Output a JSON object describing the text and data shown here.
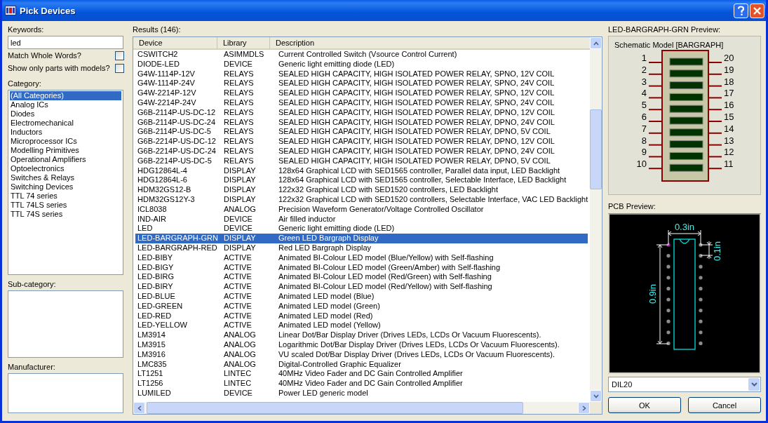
{
  "window": {
    "title": "Pick Devices"
  },
  "keywords": {
    "label": "Keywords:",
    "value": "led"
  },
  "options": [
    {
      "label": "Match Whole Words?",
      "checked": false
    },
    {
      "label": "Show only parts with models?",
      "checked": false
    }
  ],
  "category": {
    "label": "Category:",
    "items": [
      {
        "label": "(All Categories)",
        "selected": true
      },
      {
        "label": "Analog ICs",
        "selected": false
      },
      {
        "label": "Diodes",
        "selected": false
      },
      {
        "label": "Electromechanical",
        "selected": false
      },
      {
        "label": "Inductors",
        "selected": false
      },
      {
        "label": "Microprocessor ICs",
        "selected": false
      },
      {
        "label": "Modelling Primitives",
        "selected": false
      },
      {
        "label": "Operational Amplifiers",
        "selected": false
      },
      {
        "label": "Optoelectronics",
        "selected": false
      },
      {
        "label": "Switches & Relays",
        "selected": false
      },
      {
        "label": "Switching Devices",
        "selected": false
      },
      {
        "label": "TTL 74 series",
        "selected": false
      },
      {
        "label": "TTL 74LS series",
        "selected": false
      },
      {
        "label": "TTL 74S series",
        "selected": false
      }
    ]
  },
  "subcategory": {
    "label": "Sub-category:"
  },
  "manufacturer": {
    "label": "Manufacturer:"
  },
  "results": {
    "label": "Results (146):",
    "columns": [
      "Device",
      "Library",
      "Description"
    ],
    "rows": [
      {
        "device": "CSWITCH2",
        "library": "ASIMMDLS",
        "description": "Current Controlled Switch (Vsource Control Current)",
        "selected": false
      },
      {
        "device": "DIODE-LED",
        "library": "DEVICE",
        "description": "Generic light emitting diode (LED)",
        "selected": false
      },
      {
        "device": "G4W-1114P-12V",
        "library": "RELAYS",
        "description": "SEALED HIGH CAPACITY, HIGH ISOLATED POWER RELAY, SPNO, 12V COIL",
        "selected": false
      },
      {
        "device": "G4W-1114P-24V",
        "library": "RELAYS",
        "description": "SEALED HIGH CAPACITY, HIGH ISOLATED POWER RELAY, SPNO, 24V COIL",
        "selected": false
      },
      {
        "device": "G4W-2214P-12V",
        "library": "RELAYS",
        "description": "SEALED HIGH CAPACITY, HIGH ISOLATED POWER RELAY, SPNO, 12V COIL",
        "selected": false
      },
      {
        "device": "G4W-2214P-24V",
        "library": "RELAYS",
        "description": "SEALED HIGH CAPACITY, HIGH ISOLATED POWER RELAY, SPNO, 24V COIL",
        "selected": false
      },
      {
        "device": "G6B-2114P-US-DC-12",
        "library": "RELAYS",
        "description": "SEALED HIGH CAPACITY, HIGH ISOLATED POWER RELAY, DPNO, 12V COIL",
        "selected": false
      },
      {
        "device": "G6B-2114P-US-DC-24",
        "library": "RELAYS",
        "description": "SEALED HIGH CAPACITY, HIGH ISOLATED POWER RELAY, DPNO, 24V COIL",
        "selected": false
      },
      {
        "device": "G6B-2114P-US-DC-5",
        "library": "RELAYS",
        "description": "SEALED HIGH CAPACITY, HIGH ISOLATED POWER RELAY, DPNO, 5V COIL",
        "selected": false
      },
      {
        "device": "G6B-2214P-US-DC-12",
        "library": "RELAYS",
        "description": "SEALED HIGH CAPACITY, HIGH ISOLATED POWER RELAY, DPNO, 12V COIL",
        "selected": false
      },
      {
        "device": "G6B-2214P-US-DC-24",
        "library": "RELAYS",
        "description": "SEALED HIGH CAPACITY, HIGH ISOLATED POWER RELAY, DPNO, 24V COIL",
        "selected": false
      },
      {
        "device": "G6B-2214P-US-DC-5",
        "library": "RELAYS",
        "description": "SEALED HIGH CAPACITY, HIGH ISOLATED POWER RELAY, DPNO, 5V COIL",
        "selected": false
      },
      {
        "device": "HDG12864L-4",
        "library": "DISPLAY",
        "description": "128x64 Graphical LCD with SED1565 controller, Parallel data input, LED Backlight",
        "selected": false
      },
      {
        "device": "HDG12864L-6",
        "library": "DISPLAY",
        "description": "128x64 Graphical LCD with SED1565 controller, Selectable Interface, LED Backlight",
        "selected": false
      },
      {
        "device": "HDM32GS12-B",
        "library": "DISPLAY",
        "description": "122x32 Graphical LCD with SED1520 controllers, LED Backlight",
        "selected": false
      },
      {
        "device": "HDM32GS12Y-3",
        "library": "DISPLAY",
        "description": "122x32 Graphical LCD with SED1520 controllers, Selectable Interface, VAC LED Backlight",
        "selected": false
      },
      {
        "device": "ICL8038",
        "library": "ANALOG",
        "description": "Precision Waveform Generator/Voltage Controlled Oscillator",
        "selected": false
      },
      {
        "device": "IND-AIR",
        "library": "DEVICE",
        "description": "Air filled inductor",
        "selected": false
      },
      {
        "device": "LED",
        "library": "DEVICE",
        "description": "Generic light emitting diode (LED)",
        "selected": false
      },
      {
        "device": "LED-BARGRAPH-GRN",
        "library": "DISPLAY",
        "description": "Green LED Bargraph Display",
        "selected": true
      },
      {
        "device": "LED-BARGRAPH-RED",
        "library": "DISPLAY",
        "description": "Red LED Bargraph Display",
        "selected": false
      },
      {
        "device": "LED-BIBY",
        "library": "ACTIVE",
        "description": "Animated BI-Colour LED model (Blue/Yellow) with Self-flashing",
        "selected": false
      },
      {
        "device": "LED-BIGY",
        "library": "ACTIVE",
        "description": "Animated BI-Colour LED model (Green/Amber) with Self-flashing",
        "selected": false
      },
      {
        "device": "LED-BIRG",
        "library": "ACTIVE",
        "description": "Animated BI-Colour LED model (Red/Green) with Self-flashing",
        "selected": false
      },
      {
        "device": "LED-BIRY",
        "library": "ACTIVE",
        "description": "Animated BI-Colour LED model (Red/Yellow) with Self-flashing",
        "selected": false
      },
      {
        "device": "LED-BLUE",
        "library": "ACTIVE",
        "description": "Animated LED model (Blue)",
        "selected": false
      },
      {
        "device": "LED-GREEN",
        "library": "ACTIVE",
        "description": "Animated LED model (Green)",
        "selected": false
      },
      {
        "device": "LED-RED",
        "library": "ACTIVE",
        "description": "Animated LED model (Red)",
        "selected": false
      },
      {
        "device": "LED-YELLOW",
        "library": "ACTIVE",
        "description": "Animated LED model (Yellow)",
        "selected": false
      },
      {
        "device": "LM3914",
        "library": "ANALOG",
        "description": "Linear Dot/Bar Display Driver (Drives LEDs, LCDs Or Vacuum Fluorescents).",
        "selected": false
      },
      {
        "device": "LM3915",
        "library": "ANALOG",
        "description": "Logarithmic Dot/Bar Display Driver (Drives LEDs, LCDs Or Vacuum Fluorescents).",
        "selected": false
      },
      {
        "device": "LM3916",
        "library": "ANALOG",
        "description": "VU scaled Dot/Bar Display Driver (Drives LEDs, LCDs Or Vacuum Fluorescents).",
        "selected": false
      },
      {
        "device": "LMC835",
        "library": "ANALOG",
        "description": "Digital-Controlled Graphic Equalizer",
        "selected": false
      },
      {
        "device": "LT1251",
        "library": "LINTEC",
        "description": "40MHz Video Fader and  DC Gain Controlled Amplifier",
        "selected": false
      },
      {
        "device": "LT1256",
        "library": "LINTEC",
        "description": "40MHz Video Fader and  DC Gain Controlled Amplifier",
        "selected": false
      },
      {
        "device": "LUMILED",
        "library": "DEVICE",
        "description": "Power LED generic model",
        "selected": false
      }
    ]
  },
  "preview": {
    "label": "LED-BARGRAPH-GRN Preview:",
    "schematic_title": "Schematic Model [BARGRAPH]",
    "left_pins": [
      "1",
      "2",
      "3",
      "4",
      "5",
      "6",
      "7",
      "8",
      "9",
      "10"
    ],
    "right_pins": [
      "20",
      "19",
      "18",
      "17",
      "16",
      "15",
      "14",
      "13",
      "12",
      "11"
    ]
  },
  "pcb": {
    "label": "PCB Preview:",
    "width_label": "0.3in",
    "pitch_label": "0.1in",
    "length_label": "0.9in",
    "package": "DIL20"
  },
  "buttons": [
    "OK",
    "Cancel"
  ]
}
